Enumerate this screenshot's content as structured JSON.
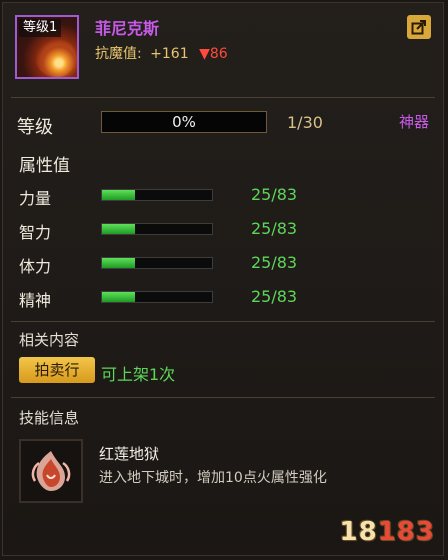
{
  "item": {
    "level_tag": "等级1",
    "name": "菲尼克斯",
    "resist_label": "抗魔值:",
    "resist_plus": "+161",
    "resist_down": "▼86"
  },
  "level": {
    "label": "等级",
    "bar_text": "0%",
    "progress": 0,
    "count": "1/30",
    "artifact_label": "神器"
  },
  "stats": {
    "header": "属性值",
    "items": [
      {
        "label": "力量",
        "value": "25/83",
        "fill": 0.3012
      },
      {
        "label": "智力",
        "value": "25/83",
        "fill": 0.3012
      },
      {
        "label": "体力",
        "value": "25/83",
        "fill": 0.3012
      },
      {
        "label": "精神",
        "value": "25/83",
        "fill": 0.3012
      }
    ]
  },
  "related": {
    "header": "相关内容",
    "auction_label": "拍卖行",
    "sell_text": "可上架1次"
  },
  "skills": {
    "header": "技能信息",
    "name": "红莲地狱",
    "description": "进入地下城时，增加10点火属性强化"
  },
  "watermark": {
    "part1": "18",
    "part2": "183"
  },
  "colors": {
    "rarity_purple": "#c85ae8",
    "stat_green": "#5ed65a",
    "gold": "#e8c56e",
    "decrease_red": "#ff4a3d"
  },
  "icons": {
    "share": "external-share-icon",
    "item": "phoenix-icon",
    "skill": "phoenix-flame-icon"
  }
}
